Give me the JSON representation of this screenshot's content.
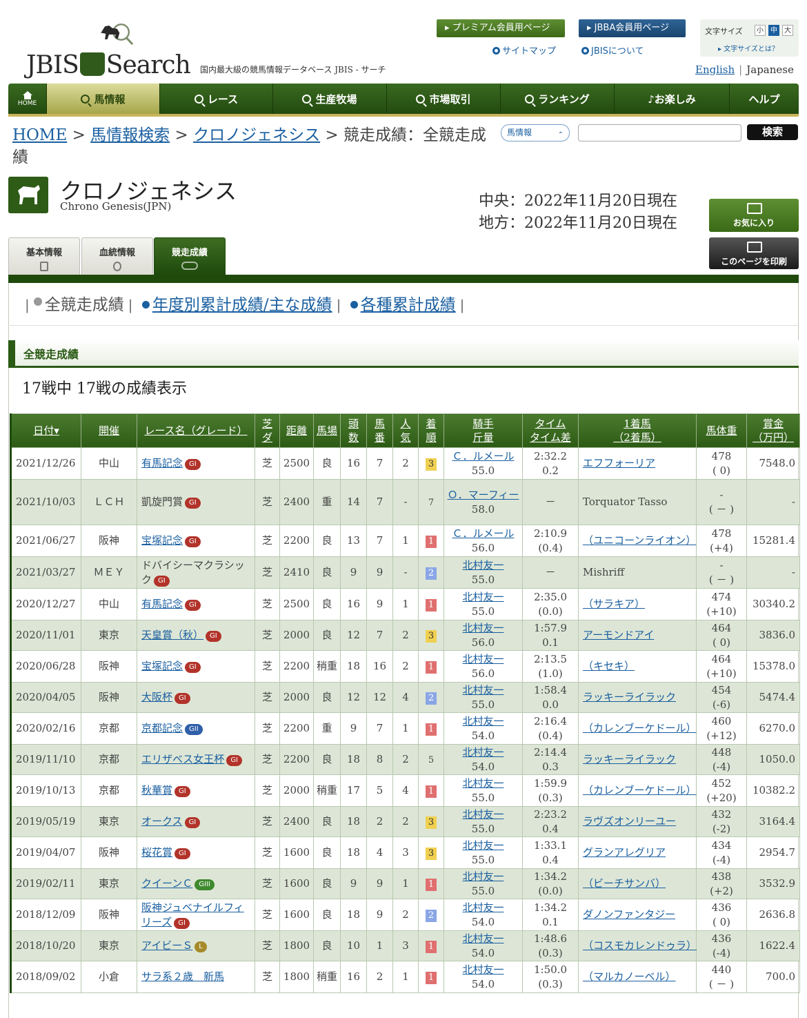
{
  "header": {
    "logo_text": "JBIS Search",
    "tagline": "国内最大級の競馬情報データベース JBIS - サーチ",
    "premium_btn": "▸ プレミアム会員用ページ",
    "jbba_btn": "▸ JBBA会員用ページ",
    "sitemap": "サイトマップ",
    "about": "JBISについて",
    "font_size_label": "文字サイズ",
    "font_small": "小",
    "font_medium": "中",
    "font_large": "大",
    "font_help": "▸ 文字サイズとは？",
    "lang_en": "English",
    "lang_ja": "Japanese"
  },
  "nav": [
    {
      "label": "HOME"
    },
    {
      "label": "馬情報"
    },
    {
      "label": "レース"
    },
    {
      "label": "生産牧場"
    },
    {
      "label": "市場取引"
    },
    {
      "label": "ランキング"
    },
    {
      "label": "♪お楽しみ"
    },
    {
      "label": "ヘルプ"
    }
  ],
  "breadcrumb": {
    "home": "HOME",
    "search": "馬情報検索",
    "horse": "クロノジェネシス",
    "current": "競走成績：全競走成績",
    "sep": ">"
  },
  "search": {
    "select": "馬情報",
    "button": "検索"
  },
  "horse": {
    "name_ja": "クロノジェネシス",
    "name_en": "Chrono Genesis(JPN)",
    "central": "中央：2022年11月20日現在",
    "local": "地方：2022年11月20日現在",
    "fav_btn": "お気に入り",
    "print_btn": "このページを印刷"
  },
  "tabs": [
    {
      "label": "基本情報"
    },
    {
      "label": "血統情報"
    },
    {
      "label": "競走成績"
    }
  ],
  "subnav": {
    "all": "全競走成績",
    "yearly": "年度別累計成績/主な成績",
    "cumulative": "各種累計成績"
  },
  "section_title": "全競走成績",
  "count_text": "17戦中 17戦の成績表示",
  "table": {
    "headers": [
      [
        "日付▾"
      ],
      [
        "開催"
      ],
      [
        "レース名（グレード）"
      ],
      [
        "芝",
        "ダ"
      ],
      [
        "距離"
      ],
      [
        "馬場"
      ],
      [
        "頭",
        "数"
      ],
      [
        "馬",
        "番"
      ],
      [
        "人",
        "気"
      ],
      [
        "着",
        "順"
      ],
      [
        "騎手",
        "斤量"
      ],
      [
        "タイム",
        "タイム差"
      ],
      [
        "1着馬",
        "（2着馬）"
      ],
      [
        "馬体重"
      ],
      [
        "賞金",
        "（万円）"
      ]
    ],
    "rows": [
      {
        "date": "2021/12/26",
        "venue": "中山",
        "race": "有馬記念",
        "grade": "GI",
        "gclass": "g1",
        "surf": "芝",
        "dist": "2500",
        "cond": "良",
        "field": "16",
        "num": "7",
        "pop": "2",
        "pos": "3",
        "jockey": "Ｃ．ルメール",
        "weight": "55.0",
        "time": "2:32.2",
        "diff": "0.2",
        "winner": "エフフォーリア",
        "wlink": true,
        "bw": "478",
        "bwd": "( 0)",
        "prize": "7548.0"
      },
      {
        "date": "2021/10/03",
        "venue": "ＬＣＨ",
        "race": "凱旋門賞",
        "grade": "GI",
        "gclass": "g1",
        "rlink": false,
        "surf": "芝",
        "dist": "2400",
        "cond": "重",
        "field": "14",
        "num": "7",
        "pop": "-",
        "pos": "7",
        "jockey": "Ｏ．マーフィー",
        "weight": "58.0",
        "time": "－",
        "diff": "",
        "winner": "Torquator Tasso",
        "wlink": false,
        "bw": "-",
        "bwd": "( － )",
        "prize": "-"
      },
      {
        "date": "2021/06/27",
        "venue": "阪神",
        "race": "宝塚記念",
        "grade": "GI",
        "gclass": "g1",
        "surf": "芝",
        "dist": "2200",
        "cond": "良",
        "field": "13",
        "num": "7",
        "pop": "1",
        "pos": "1",
        "jockey": "Ｃ．ルメール",
        "weight": "56.0",
        "time": "2:10.9",
        "diff": "(0.4)",
        "winner": "（ユニコーンライオン）",
        "wlink": true,
        "bw": "478",
        "bwd": "(+4)",
        "prize": "15281.4"
      },
      {
        "date": "2021/03/27",
        "venue": "ＭＥＹ",
        "race": "ドバイシーマクラシック",
        "grade": "GI",
        "gclass": "g1",
        "rlink": false,
        "surf": "芝",
        "dist": "2410",
        "cond": "良",
        "field": "9",
        "num": "9",
        "pop": "-",
        "pos": "2",
        "jockey": "北村友一",
        "weight": "55.0",
        "time": "－",
        "diff": "",
        "winner": "Mishriff",
        "wlink": false,
        "bw": "-",
        "bwd": "( － )",
        "prize": "-"
      },
      {
        "date": "2020/12/27",
        "venue": "中山",
        "race": "有馬記念",
        "grade": "GI",
        "gclass": "g1",
        "surf": "芝",
        "dist": "2500",
        "cond": "良",
        "field": "16",
        "num": "9",
        "pop": "1",
        "pos": "1",
        "jockey": "北村友一",
        "weight": "55.0",
        "time": "2:35.0",
        "diff": "(0.0)",
        "winner": "（サラキア）",
        "wlink": true,
        "bw": "474",
        "bwd": "(+10)",
        "prize": "30340.2"
      },
      {
        "date": "2020/11/01",
        "venue": "東京",
        "race": "天皇賞（秋）",
        "grade": "GI",
        "gclass": "g1",
        "surf": "芝",
        "dist": "2000",
        "cond": "良",
        "field": "12",
        "num": "7",
        "pop": "2",
        "pos": "3",
        "jockey": "北村友一",
        "weight": "56.0",
        "time": "1:57.9",
        "diff": "0.1",
        "winner": "アーモンドアイ",
        "wlink": true,
        "bw": "464",
        "bwd": "( 0)",
        "prize": "3836.0"
      },
      {
        "date": "2020/06/28",
        "venue": "阪神",
        "race": "宝塚記念",
        "grade": "GI",
        "gclass": "g1",
        "surf": "芝",
        "dist": "2200",
        "cond": "稍重",
        "field": "18",
        "num": "16",
        "pop": "2",
        "pos": "1",
        "jockey": "北村友一",
        "weight": "56.0",
        "time": "2:13.5",
        "diff": "(1.0)",
        "winner": "（キセキ）",
        "wlink": true,
        "bw": "464",
        "bwd": "(+10)",
        "prize": "15378.0"
      },
      {
        "date": "2020/04/05",
        "venue": "阪神",
        "race": "大阪杯",
        "grade": "GI",
        "gclass": "g1",
        "surf": "芝",
        "dist": "2000",
        "cond": "良",
        "field": "12",
        "num": "12",
        "pop": "4",
        "pos": "2",
        "jockey": "北村友一",
        "weight": "55.0",
        "time": "1:58.4",
        "diff": "0.0",
        "winner": "ラッキーライラック",
        "wlink": true,
        "bw": "454",
        "bwd": "(-6)",
        "prize": "5474.4"
      },
      {
        "date": "2020/02/16",
        "venue": "京都",
        "race": "京都記念",
        "grade": "GII",
        "gclass": "g2",
        "surf": "芝",
        "dist": "2200",
        "cond": "重",
        "field": "9",
        "num": "7",
        "pop": "1",
        "pos": "1",
        "jockey": "北村友一",
        "weight": "54.0",
        "time": "2:16.4",
        "diff": "(0.4)",
        "winner": "（カレンブーケドール）",
        "wlink": true,
        "bw": "460",
        "bwd": "(+12)",
        "prize": "6270.0"
      },
      {
        "date": "2019/11/10",
        "venue": "京都",
        "race": "エリザベス女王杯",
        "grade": "GI",
        "gclass": "g1",
        "surf": "芝",
        "dist": "2200",
        "cond": "良",
        "field": "18",
        "num": "8",
        "pop": "2",
        "pos": "5",
        "jockey": "北村友一",
        "weight": "54.0",
        "time": "2:14.4",
        "diff": "0.3",
        "winner": "ラッキーライラック",
        "wlink": true,
        "bw": "448",
        "bwd": "(-4)",
        "prize": "1050.0"
      },
      {
        "date": "2019/10/13",
        "venue": "京都",
        "race": "秋華賞",
        "grade": "GI",
        "gclass": "g1",
        "surf": "芝",
        "dist": "2000",
        "cond": "稍重",
        "field": "17",
        "num": "5",
        "pop": "4",
        "pos": "1",
        "jockey": "北村友一",
        "weight": "55.0",
        "time": "1:59.9",
        "diff": "(0.3)",
        "winner": "（カレンブーケドール）",
        "wlink": true,
        "bw": "452",
        "bwd": "(+20)",
        "prize": "10382.2"
      },
      {
        "date": "2019/05/19",
        "venue": "東京",
        "race": "オークス",
        "grade": "GI",
        "gclass": "g1",
        "surf": "芝",
        "dist": "2400",
        "cond": "良",
        "field": "18",
        "num": "2",
        "pop": "2",
        "pos": "3",
        "jockey": "北村友一",
        "weight": "55.0",
        "time": "2:23.2",
        "diff": "0.4",
        "winner": "ラヴズオンリーユー",
        "wlink": true,
        "bw": "432",
        "bwd": "(-2)",
        "prize": "3164.4"
      },
      {
        "date": "2019/04/07",
        "venue": "阪神",
        "race": "桜花賞",
        "grade": "GI",
        "gclass": "g1",
        "surf": "芝",
        "dist": "1600",
        "cond": "良",
        "field": "18",
        "num": "4",
        "pop": "3",
        "pos": "3",
        "jockey": "北村友一",
        "weight": "55.0",
        "time": "1:33.1",
        "diff": "0.4",
        "winner": "グランアレグリア",
        "wlink": true,
        "bw": "434",
        "bwd": "(-4)",
        "prize": "2954.7"
      },
      {
        "date": "2019/02/11",
        "venue": "東京",
        "race": "クイーンＣ",
        "grade": "GIII",
        "gclass": "g3",
        "surf": "芝",
        "dist": "1600",
        "cond": "良",
        "field": "9",
        "num": "9",
        "pop": "1",
        "pos": "1",
        "jockey": "北村友一",
        "weight": "55.0",
        "time": "1:34.2",
        "diff": "(0.0)",
        "winner": "（ビーチサンバ）",
        "wlink": true,
        "bw": "438",
        "bwd": "(+2)",
        "prize": "3532.9"
      },
      {
        "date": "2018/12/09",
        "venue": "阪神",
        "race": "阪神ジュベナイルフィリーズ",
        "grade": "GI",
        "gclass": "g1",
        "surf": "芝",
        "dist": "1600",
        "cond": "良",
        "field": "18",
        "num": "9",
        "pop": "2",
        "pos": "2",
        "jockey": "北村友一",
        "weight": "54.0",
        "time": "1:34.2",
        "diff": "0.1",
        "winner": "ダノンファンタジー",
        "wlink": true,
        "bw": "436",
        "bwd": "( 0)",
        "prize": "2636.8"
      },
      {
        "date": "2018/10/20",
        "venue": "東京",
        "race": "アイビーＳ",
        "grade": "L",
        "gclass": "l",
        "surf": "芝",
        "dist": "1800",
        "cond": "良",
        "field": "10",
        "num": "1",
        "pop": "3",
        "pos": "1",
        "jockey": "北村友一",
        "weight": "54.0",
        "time": "1:48.6",
        "diff": "(0.3)",
        "winner": "（コスモカレンドゥラ）",
        "wlink": true,
        "bw": "436",
        "bwd": "(-4)",
        "prize": "1622.4"
      },
      {
        "date": "2018/09/02",
        "venue": "小倉",
        "race": "サラ系２歳　新馬",
        "grade": "",
        "gclass": "",
        "surf": "芝",
        "dist": "1800",
        "cond": "稍重",
        "field": "16",
        "num": "2",
        "pop": "1",
        "pos": "1",
        "jockey": "北村友一",
        "weight": "54.0",
        "time": "1:50.0",
        "diff": "(0.3)",
        "winner": "（マルカノーベル）",
        "wlink": true,
        "bw": "440",
        "bwd": "( － )",
        "prize": "700.0"
      }
    ]
  }
}
